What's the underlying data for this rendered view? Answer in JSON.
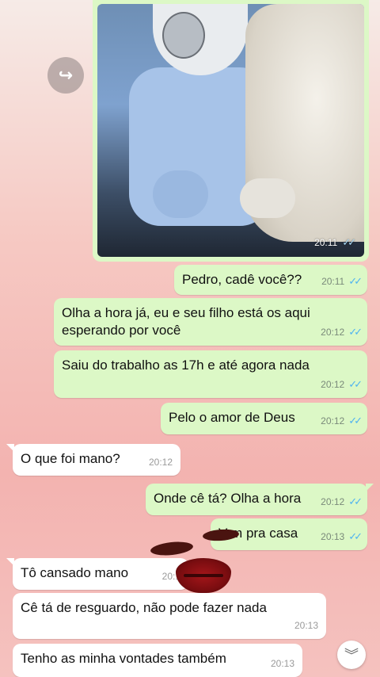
{
  "photo_message": {
    "time": "20:11",
    "ticks": "✓✓",
    "description_icon": "baby-photo"
  },
  "forward": {
    "icon": "forward-icon",
    "glyph": "↪"
  },
  "messages": [
    {
      "dir": "out",
      "text": "Pedro, cadê você??",
      "time": "20:11",
      "ticks": "✓✓"
    },
    {
      "dir": "out",
      "text_lines": [
        "Olha a hora já, eu e seu filho está os aqui",
        "esperando por você"
      ],
      "time": "20:12",
      "ticks": "✓✓"
    },
    {
      "dir": "out",
      "text": "Saiu do trabalho as 17h e até agora nada",
      "time": "20:12",
      "ticks": "✓✓"
    },
    {
      "dir": "out",
      "text": "Pelo o amor de Deus",
      "time": "20:12",
      "ticks": "✓✓"
    },
    {
      "dir": "in",
      "text": "O que foi mano?",
      "time": "20:12"
    },
    {
      "dir": "out",
      "text": "Onde cê tá? Olha a hora",
      "time": "20:12",
      "ticks": "✓✓"
    },
    {
      "dir": "out",
      "text": "V  m pra casa",
      "time": "20:13",
      "ticks": "✓✓"
    },
    {
      "dir": "in",
      "text": "Tô cansado mano",
      "time": "20:1"
    },
    {
      "dir": "in",
      "text": "Cê tá de resguardo, não pode fazer nada",
      "time": "20:13"
    },
    {
      "dir": "in",
      "text": "Tenho as minha vontades também",
      "time": "20:13"
    }
  ],
  "scroll_down": {
    "icon": "double-chevron-down-icon",
    "glyph": "︾"
  },
  "colors": {
    "outgoing": "#dcf8c6",
    "incoming": "#ffffff",
    "ticks": "#4fb3f0"
  }
}
